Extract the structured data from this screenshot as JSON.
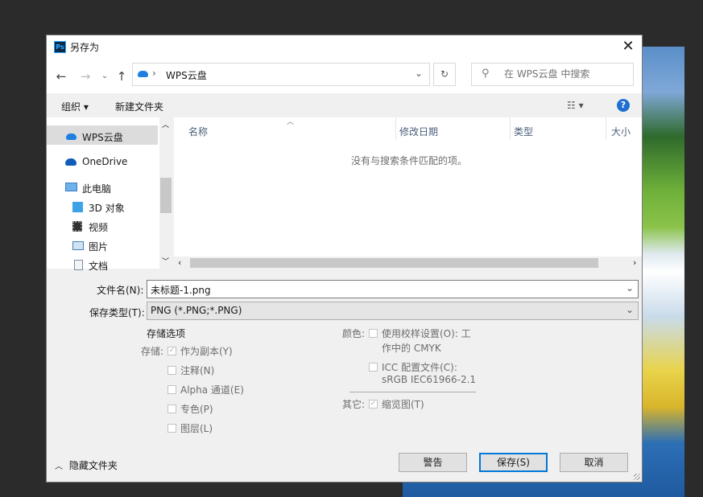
{
  "window": {
    "title": "另存为",
    "app_icon": "Ps"
  },
  "nav": {
    "path": "WPS云盘",
    "search_placeholder": "在 WPS云盘 中搜索"
  },
  "toolbar": {
    "organize": "组织 ▾",
    "new_folder": "新建文件夹",
    "help": "?"
  },
  "sidebar": {
    "items": [
      "WPS云盘",
      "OneDrive",
      "此电脑",
      "3D 对象",
      "视频",
      "图片",
      "文档"
    ]
  },
  "files": {
    "columns": [
      "名称",
      "修改日期",
      "类型",
      "大小"
    ],
    "empty_message": "没有与搜索条件匹配的项。"
  },
  "form": {
    "filename_label": "文件名(N):",
    "filename": "未标题-1.png",
    "type_label": "保存类型(T):",
    "type": "PNG (*.PNG;*.PNG)"
  },
  "options": {
    "title": "存储选项",
    "save_label": "存储:",
    "as_copy": "作为副本(Y)",
    "notes": "注释(N)",
    "alpha": "Alpha 通道(E)",
    "spot": "专色(P)",
    "layers": "图层(L)",
    "color_label": "颜色:",
    "proof_line1": "使用校样设置(O): 工",
    "proof_line2": "作中的 CMYK",
    "icc_line1": "ICC 配置文件(C):",
    "icc_line2": "sRGB IEC61966-2.1",
    "other_label": "其它:",
    "thumbnail": "缩览图(T)"
  },
  "buttons": {
    "warning": "警告",
    "save": "保存(S)",
    "cancel": "取消",
    "hide_folders": "隐藏文件夹"
  },
  "colors": {
    "accent": "#0078d7",
    "cloud": "#1e7fe0"
  }
}
